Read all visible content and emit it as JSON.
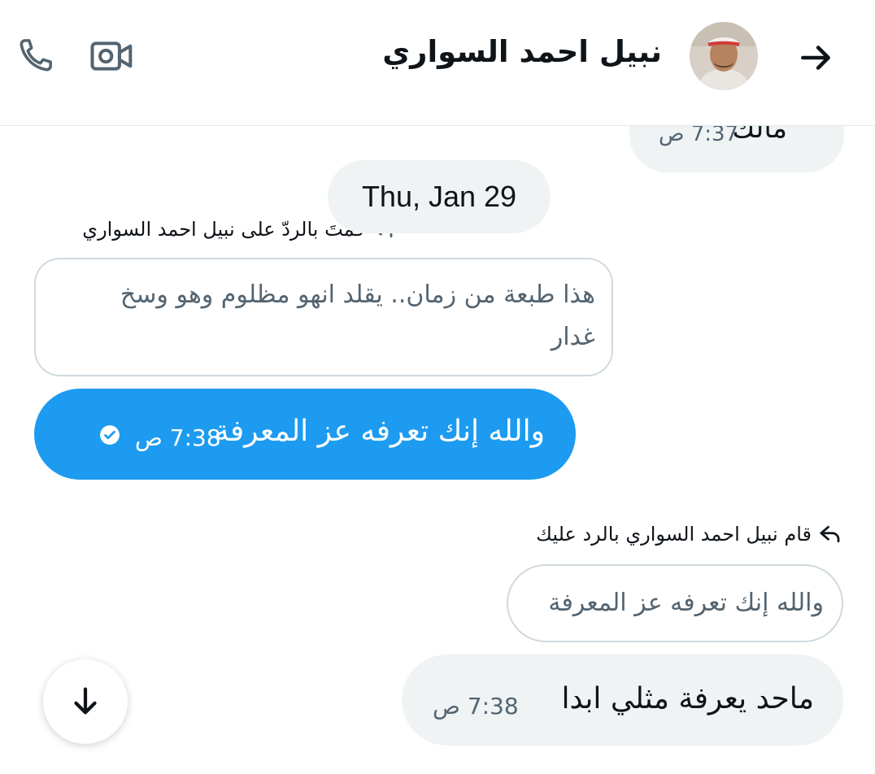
{
  "header": {
    "contact_name": "نبيل احمد السواري",
    "back_icon": "arrow-right-icon",
    "call_icon": "phone-icon",
    "video_icon": "video-camera-icon"
  },
  "messages": {
    "partial_top": {
      "text": "مالك",
      "time": "7:37 ص"
    },
    "date_separator": "Thu, Jan 29",
    "reply1": {
      "label": "قمتَ بالردّ على نبيل احمد السواري",
      "quoted_line1": "هذا طبعة من زمان.. يقلد انهو مظلوم وهو وسخ",
      "quoted_line2": "غدار"
    },
    "sent1": {
      "text": "والله إنك تعرفه عز المعرفة",
      "time": "7:38 ص"
    },
    "reply2": {
      "label": "قام نبيل احمد السواري بالرد عليك",
      "quoted": "والله إنك تعرفه عز المعرفة"
    },
    "recv1": {
      "text": "ماحد يعرفة مثلي ابدا",
      "time": "7:38 ص"
    }
  },
  "colors": {
    "accent": "#1d9bf0",
    "received_bg": "#eff3f4",
    "border": "#cfd9de"
  },
  "scroll_button_icon": "arrow-down-icon"
}
